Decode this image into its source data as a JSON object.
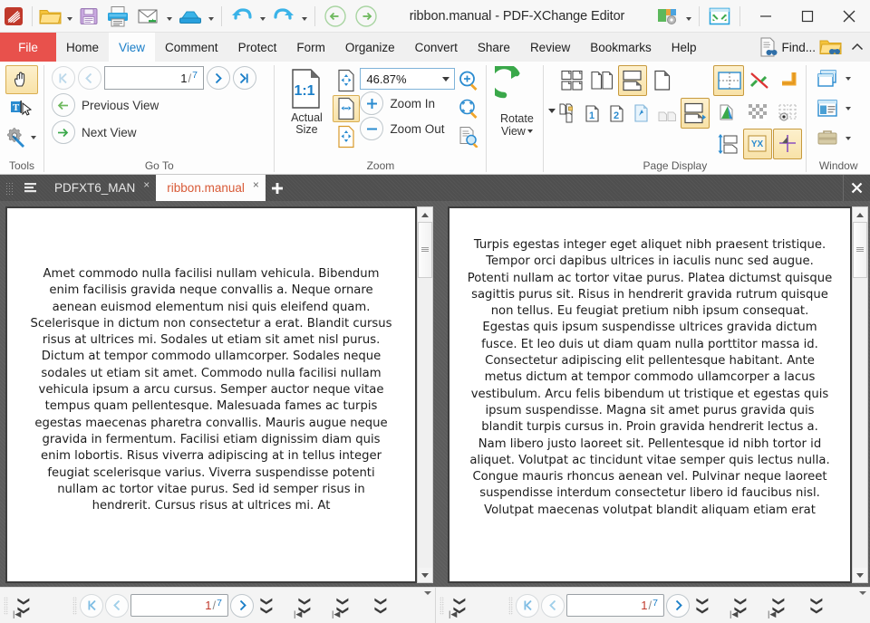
{
  "titlebar": {
    "title": "ribbon.manual - PDF-XChange Editor",
    "quick_access": [
      {
        "name": "app-logo-icon",
        "label": "PDF-XChange"
      },
      {
        "name": "open-file-icon",
        "label": "Open"
      },
      {
        "name": "save-file-icon",
        "label": "Save"
      },
      {
        "name": "print-icon",
        "label": "Print"
      },
      {
        "name": "email-icon",
        "label": "Email"
      },
      {
        "name": "scan-icon",
        "label": "Scan"
      },
      {
        "name": "undo-icon",
        "label": "Undo"
      },
      {
        "name": "redo-icon",
        "label": "Redo"
      },
      {
        "name": "back-icon",
        "label": "Previous View"
      },
      {
        "name": "forward-icon",
        "label": "Next View"
      }
    ],
    "customize_label": "Customize Quick Access Toolbar",
    "fullscreen_label": "Full Screen",
    "minimize_label": "Minimize",
    "maximize_label": "Maximize",
    "close_label": "Close"
  },
  "ribbon_tabs": {
    "file": "File",
    "tabs": [
      {
        "label": "Home",
        "active": false
      },
      {
        "label": "View",
        "active": true
      },
      {
        "label": "Comment",
        "active": false
      },
      {
        "label": "Protect",
        "active": false
      },
      {
        "label": "Form",
        "active": false
      },
      {
        "label": "Organize",
        "active": false
      },
      {
        "label": "Convert",
        "active": false
      },
      {
        "label": "Share",
        "active": false
      },
      {
        "label": "Review",
        "active": false
      },
      {
        "label": "Bookmarks",
        "active": false
      },
      {
        "label": "Help",
        "active": false
      }
    ],
    "find_label": "Find...",
    "search_folder_label": "Search Folder",
    "collapse_label": "Collapse Ribbon"
  },
  "ribbon": {
    "tools": {
      "group_label": "Tools",
      "hand_tool": "Hand Tool",
      "select_text_tool": "Select Text Tool",
      "settings_tool": "Tool Settings"
    },
    "goto": {
      "group_label": "Go To",
      "first_page": "First Page",
      "previous_page": "Previous Page",
      "next_page": "Next Page",
      "last_page": "Last Page",
      "current_page": "1",
      "separator": "/",
      "total_pages": "7",
      "previous_view": "Previous View",
      "next_view": "Next View"
    },
    "zoom": {
      "group_label": "Zoom",
      "actual_size_badge": "1:1",
      "actual_size_line1": "Actual",
      "actual_size_line2": "Size",
      "zoom_level": "46.87%",
      "zoom_in": "Zoom In",
      "zoom_out": "Zoom Out",
      "fit_page": "Fit Page",
      "fit_width": "Fit Width",
      "fit_visible": "Fit Visible",
      "magnifier": "Zoom Tool",
      "pan_zoom": "Pan and Zoom",
      "loupe": "Loupe Tool"
    },
    "rotate": {
      "line1": "Rotate",
      "line2": "View"
    },
    "page_display": {
      "group_label": "Page Display",
      "more_label": "More Page Display Options",
      "row1": [
        {
          "name": "page-display-tiled",
          "label": "Tiled",
          "selected": false
        },
        {
          "name": "page-display-two-page",
          "label": "Two Pages",
          "selected": false
        },
        {
          "name": "page-display-continuous",
          "label": "Continuous",
          "selected": true
        },
        {
          "name": "page-display-single",
          "label": "Single Page",
          "selected": false
        }
      ],
      "row2": [
        {
          "name": "page-display-cover-lock",
          "label": "Cover Page",
          "selected": false
        },
        {
          "name": "page-display-page-order-1",
          "label": "Page Order 1",
          "selected": false
        },
        {
          "name": "page-display-page-order-2",
          "label": "Page Order 2",
          "selected": false
        },
        {
          "name": "page-display-highlight",
          "label": "Highlight Fields",
          "selected": false
        },
        {
          "name": "page-display-split-horizontal",
          "label": "Split Horizontally",
          "selected": false
        },
        {
          "name": "page-display-scroll-lock",
          "label": "Scroll Lock",
          "selected": true
        }
      ],
      "extras": [
        {
          "name": "page-display-rulers",
          "label": "Rulers",
          "selected": true
        },
        {
          "name": "snap-off-icon",
          "label": "Snap Off",
          "selected": false
        },
        {
          "name": "measure-icon",
          "label": "Measurement",
          "selected": false
        },
        {
          "name": "layers-icon",
          "label": "Layers",
          "selected": false
        },
        {
          "name": "transparency-grid-icon",
          "label": "Transparency Grid",
          "selected": false
        },
        {
          "name": "grid-visibility-icon",
          "label": "Grid",
          "selected": false
        },
        {
          "name": "auto-scroll-icon",
          "label": "Auto Scroll",
          "selected": false
        },
        {
          "name": "coordinates-icon",
          "label": "YX Coordinates",
          "selected": true
        },
        {
          "name": "crosshair-icon",
          "label": "Crosshair",
          "selected": true
        }
      ]
    },
    "window": {
      "group_label": "Window",
      "items": [
        {
          "name": "new-window-icon",
          "label": "New Window"
        },
        {
          "name": "split-layout-icon",
          "label": "Split Layout"
        },
        {
          "name": "toolbox-icon",
          "label": "Panes"
        }
      ]
    }
  },
  "doc_tabs": {
    "grip_label": "Drag Handle",
    "list_label": "Document List",
    "tabs": [
      {
        "label": "PDFXT6_MAN",
        "close": "×",
        "active": false
      },
      {
        "label": "ribbon.manual",
        "close": "×",
        "active": true
      }
    ],
    "new_tab": "+",
    "close_all": "✕"
  },
  "documents": {
    "left": {
      "name": "PDFXT6_MAN",
      "body": "Amet commodo nulla facilisi nullam vehicula. Bibendum enim facilisis gravida neque convallis a. Neque ornare aenean euismod elementum nisi quis eleifend quam. Scelerisque in dictum non consectetur a erat. Blandit cursus risus at ultrices mi. Sodales ut etiam sit amet nisl purus. Dictum at tempor commodo ullamcorper. Sodales neque sodales ut etiam sit amet. Commodo nulla facilisi nullam vehicula ipsum a arcu cursus. Semper auctor neque vitae tempus quam pellentesque. Malesuada fames ac turpis egestas maecenas pharetra convallis. Mauris augue neque gravida in fermentum. Facilisi etiam dignissim diam quis enim lobortis. Risus viverra adipiscing at in tellus integer feugiat scelerisque varius. Viverra suspendisse potenti nullam ac tortor vitae purus. Sed id semper risus in hendrerit. Cursus risus at ultrices mi. At"
    },
    "right": {
      "name": "ribbon.manual",
      "body": "Turpis egestas integer eget aliquet nibh praesent tristique. Tempor orci dapibus ultrices in iaculis nunc sed augue. Potenti nullam ac tortor vitae purus. Platea dictumst quisque sagittis purus sit. Risus in hendrerit gravida rutrum quisque non tellus. Eu feugiat pretium nibh ipsum consequat. Egestas quis ipsum suspendisse ultrices gravida dictum fusce. Et leo duis ut diam quam nulla porttitor massa id. Consectetur adipiscing elit pellentesque habitant. Ante metus dictum at tempor commodo ullamcorper a lacus vestibulum. Arcu felis bibendum ut tristique et egestas quis ipsum suspendisse. Magna sit amet purus gravida quis blandit turpis cursus in. Proin gravida hendrerit lectus a. Nam libero justo laoreet sit. Pellentesque id nibh tortor id aliquet. Volutpat ac tincidunt vitae semper quis lectus nulla. Congue mauris rhoncus aenean vel. Pulvinar neque laoreet suspendisse interdum consectetur libero id faucibus nisl. Volutpat maecenas volutpat blandit aliquam etiam erat"
    }
  },
  "status_bars": {
    "left": {
      "current_page": "1",
      "separator": "/",
      "total_pages": "7",
      "first_page": "First Page",
      "previous_page": "Previous Page",
      "next_page": "Next Page",
      "overflow_label": "More Commands"
    },
    "right": {
      "current_page": "1",
      "separator": "/",
      "total_pages": "7",
      "first_page": "First Page",
      "previous_page": "Previous Page",
      "next_page": "Next Page",
      "overflow_label": "More Commands"
    }
  },
  "colors": {
    "file_tab": "#e8514c",
    "accent_blue": "#1a7ec8",
    "active_doc_tab_text": "#d85a37",
    "ribbon_bg": "#fdfdfd",
    "doc_bg": "#5c5c5c",
    "selected_tool": "#f8e2a8"
  }
}
